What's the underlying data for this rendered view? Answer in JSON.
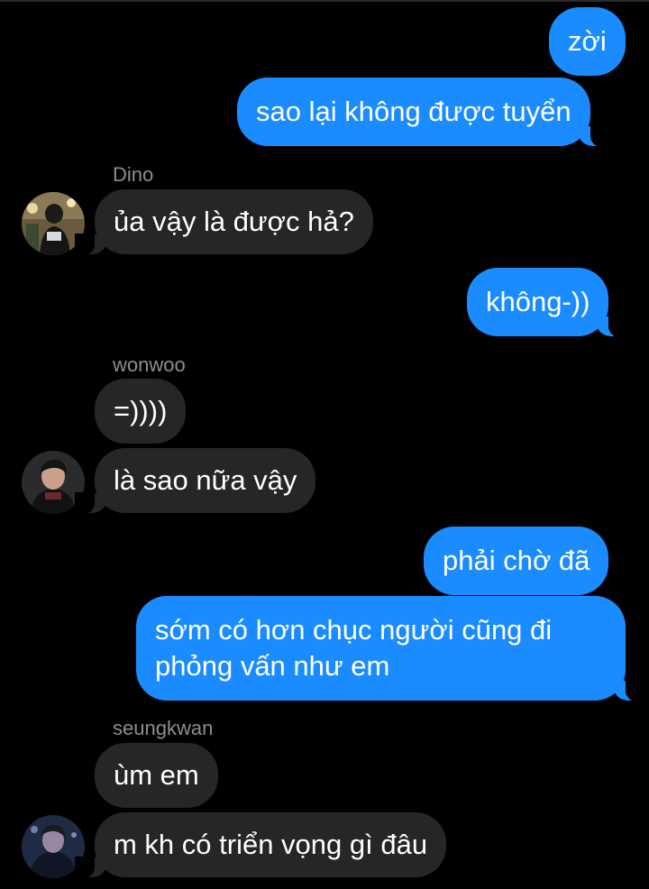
{
  "messages": {
    "m1": "zời",
    "m2": "sao lại không được tuyển",
    "m3": "ủa vậy là được hả?",
    "m4": "không-))",
    "m5": "=))))",
    "m6": "là sao nữa vậy",
    "m7": "phải chờ đã",
    "m8": "sớm có hơn chục người cũng đi phỏng vấn như em",
    "m9": "ùm em",
    "m10": "m kh có triển vọng gì đâu"
  },
  "senders": {
    "s1": "Dino",
    "s2": "wonwoo",
    "s3": "seungkwan"
  },
  "colors": {
    "outgoing_bubble": "#1a8cff",
    "incoming_bubble": "#262628",
    "background": "#000000",
    "sender_name": "#8e8e93"
  }
}
